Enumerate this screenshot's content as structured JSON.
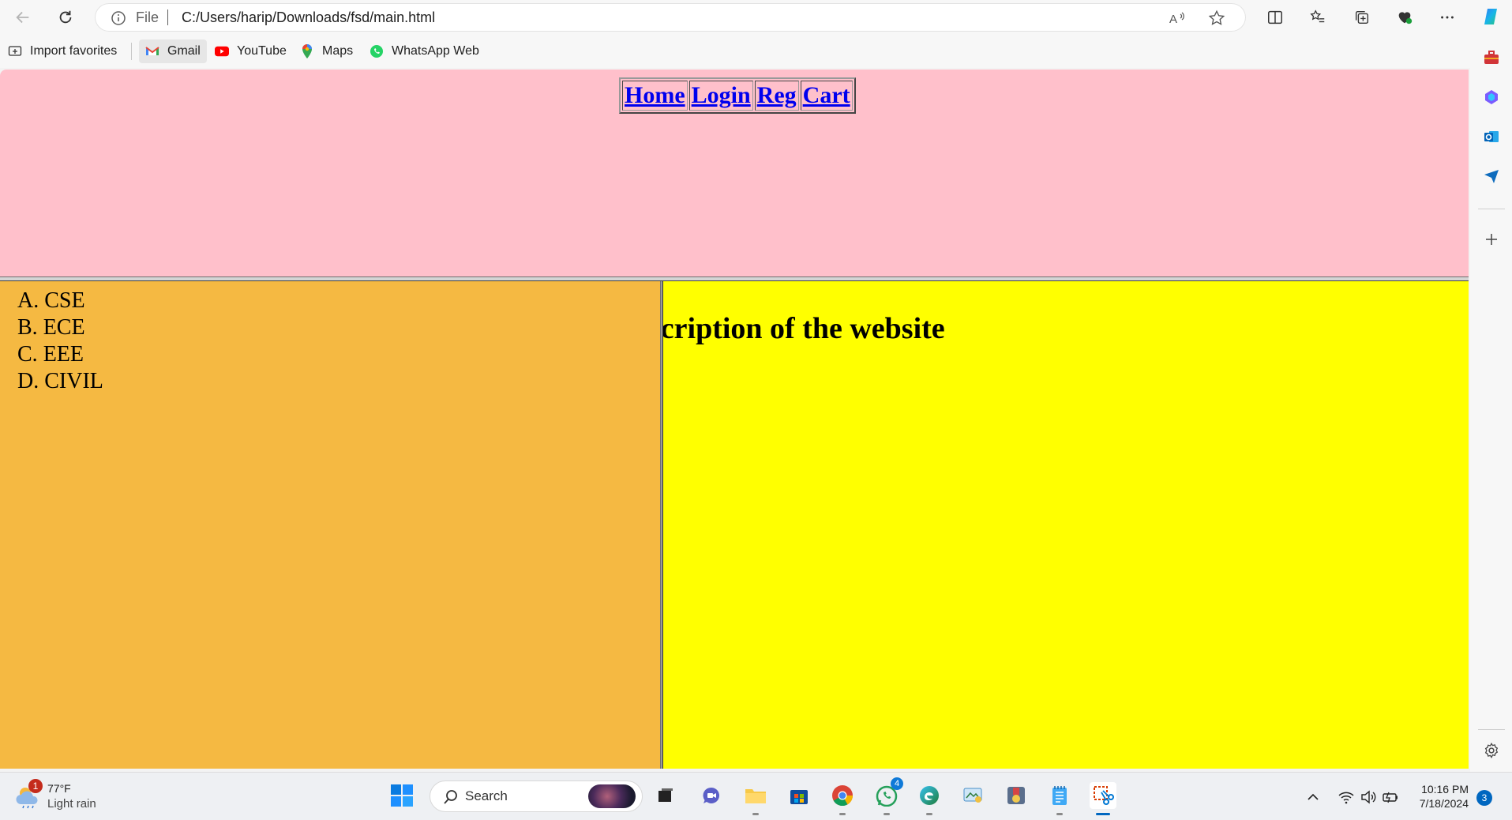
{
  "browser": {
    "address": {
      "scheme_label": "File",
      "url": "C:/Users/harip/Downloads/fsd/main.html"
    },
    "favorites": [
      {
        "label": "Import favorites",
        "icon": "import-icon"
      },
      {
        "label": "Gmail",
        "icon": "gmail-icon"
      },
      {
        "label": "YouTube",
        "icon": "youtube-icon"
      },
      {
        "label": "Maps",
        "icon": "maps-icon"
      },
      {
        "label": "WhatsApp Web",
        "icon": "whatsapp-icon"
      }
    ]
  },
  "page": {
    "nav_links": [
      "Home",
      "Login",
      "Reg",
      "Cart"
    ],
    "branches": [
      {
        "marker": "A.",
        "label": "CSE"
      },
      {
        "marker": "B.",
        "label": "ECE"
      },
      {
        "marker": "C.",
        "label": "EEE"
      },
      {
        "marker": "D.",
        "label": "CIVIL"
      }
    ],
    "description": "scription of the website",
    "colors": {
      "top": "#ffc0cb",
      "left": "#f5b942",
      "right": "#ffff00",
      "link": "#0000ee"
    }
  },
  "taskbar": {
    "weather": {
      "temp": "77°F",
      "condition": "Light rain",
      "badge": "1"
    },
    "search_label": "Search",
    "whatsapp_badge": "4",
    "clock": {
      "time": "10:16 PM",
      "date": "7/18/2024"
    },
    "notifications": "3"
  }
}
